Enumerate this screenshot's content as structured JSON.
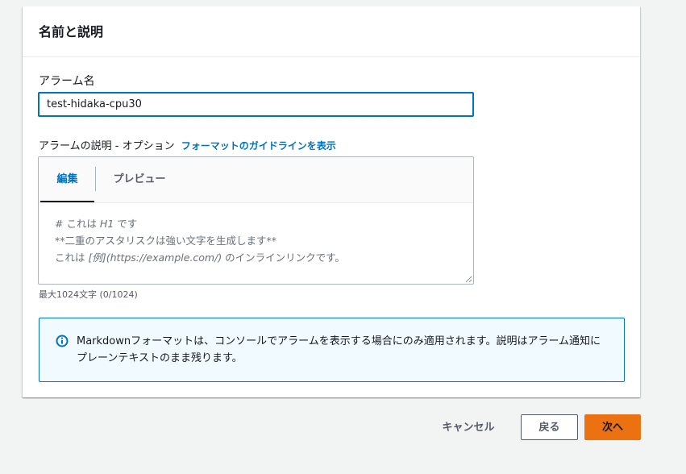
{
  "section": {
    "title": "名前と説明"
  },
  "alarm_name": {
    "label": "アラーム名",
    "value": "test-hidaka-cpu30"
  },
  "description": {
    "label": "アラームの説明 - オプション",
    "guideline_link": "フォーマットのガイドラインを表示",
    "tabs": [
      "編集",
      "プレビュー"
    ],
    "placeholder_line1_prefix": "# これは ",
    "placeholder_line1_em": "H1",
    "placeholder_line1_suffix": " です",
    "placeholder_line2": "**二重のアスタリスクは強い文字を生成します**",
    "placeholder_line3_prefix": "これは ",
    "placeholder_line3_em": "[例](https://example.com/)",
    "placeholder_line3_suffix": " のインラインリンクです。",
    "char_limit": "最大1024文字 (0/1024)"
  },
  "info": {
    "icon": "info-icon",
    "text": "Markdownフォーマットは、コンソールでアラームを表示する場合にのみ適用されます。説明はアラーム通知にプレーンテキストのまま残ります。"
  },
  "footer": {
    "cancel": "キャンセル",
    "back": "戻る",
    "next": "次へ"
  },
  "colors": {
    "accent": "#0073bb",
    "primary_button": "#ec7211",
    "info_background": "#f1faff"
  }
}
